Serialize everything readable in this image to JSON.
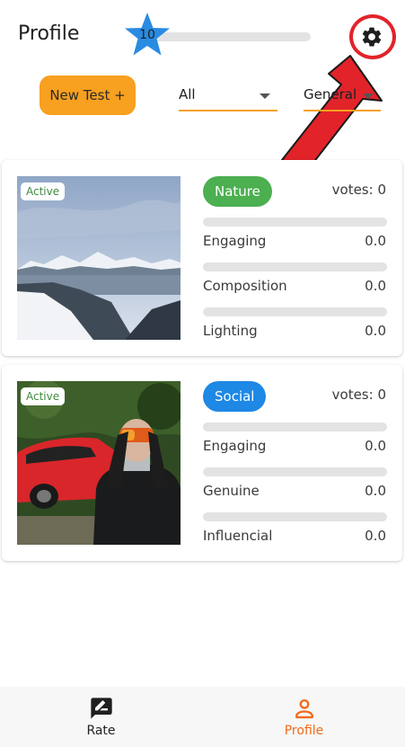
{
  "header": {
    "title": "Profile",
    "level": "10",
    "progress": 0.0,
    "settings_icon": "gear-icon"
  },
  "controls": {
    "new_test_label": "New Test +",
    "filter_value": "All",
    "category_value": "General"
  },
  "tests": [
    {
      "status": "Active",
      "category": "Nature",
      "category_color": "#4caf50",
      "votes_text": "votes: 0",
      "photo": "mountain-lake-photo",
      "metrics": [
        {
          "label": "Engaging",
          "value": "0.0",
          "fraction": 0.0
        },
        {
          "label": "Composition",
          "value": "0.0",
          "fraction": 0.0
        },
        {
          "label": "Lighting",
          "value": "0.0",
          "fraction": 0.0
        }
      ]
    },
    {
      "status": "Active",
      "category": "Social",
      "category_color": "#1e88e5",
      "votes_text": "votes: 0",
      "photo": "person-with-red-car-photo",
      "metrics": [
        {
          "label": "Engaging",
          "value": "0.0",
          "fraction": 0.0
        },
        {
          "label": "Genuine",
          "value": "0.0",
          "fraction": 0.0
        },
        {
          "label": "Influencial",
          "value": "0.0",
          "fraction": 0.0
        }
      ]
    }
  ],
  "nav": {
    "rate_label": "Rate",
    "profile_label": "Profile",
    "active": "profile",
    "active_color": "#f26a1b",
    "inactive_color": "#222222"
  },
  "annotation": {
    "highlight_color": "#e2232a"
  }
}
